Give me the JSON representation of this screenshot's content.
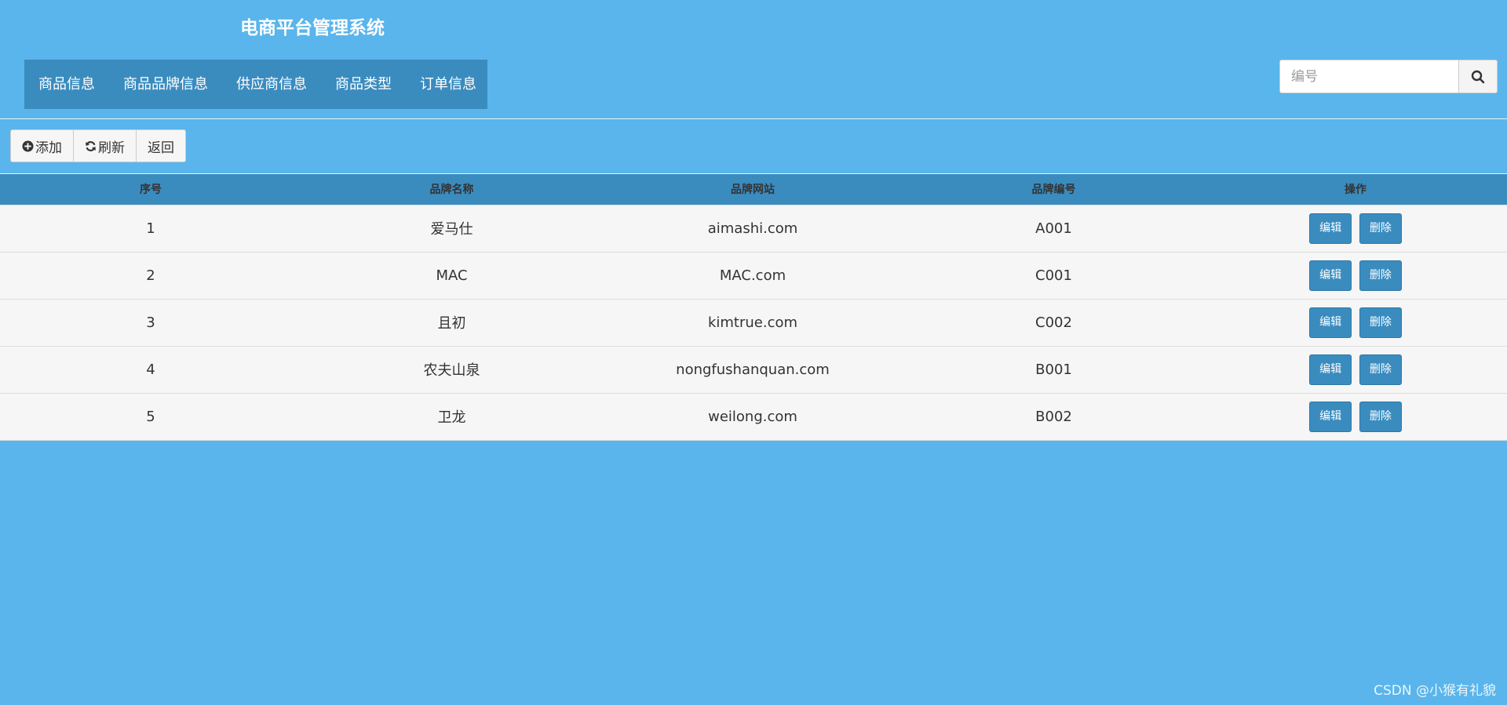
{
  "header": {
    "title": "电商平台管理系统",
    "nav": [
      {
        "label": "商品信息"
      },
      {
        "label": "商品品牌信息"
      },
      {
        "label": "供应商信息"
      },
      {
        "label": "商品类型"
      },
      {
        "label": "订单信息"
      }
    ],
    "search": {
      "placeholder": "编号",
      "value": "",
      "button_icon": "search-icon"
    }
  },
  "toolbar": {
    "add_label": "添加",
    "add_icon": "plus-circle-icon",
    "refresh_label": "刷新",
    "refresh_icon": "refresh-icon",
    "back_label": "返回"
  },
  "table": {
    "columns": [
      "序号",
      "品牌名称",
      "品牌网站",
      "品牌编号",
      "操作"
    ],
    "rows": [
      {
        "index": "1",
        "name": "爱马仕",
        "site": "aimashi.com",
        "code": "A001",
        "edit": "编辑",
        "delete": "删除"
      },
      {
        "index": "2",
        "name": "MAC",
        "site": "MAC.com",
        "code": "C001",
        "edit": "编辑",
        "delete": "删除"
      },
      {
        "index": "3",
        "name": "且初",
        "site": "kimtrue.com",
        "code": "C002",
        "edit": "编辑",
        "delete": "删除"
      },
      {
        "index": "4",
        "name": "农夫山泉",
        "site": "nongfushanquan.com",
        "code": "B001",
        "edit": "编辑",
        "delete": "删除"
      },
      {
        "index": "5",
        "name": "卫龙",
        "site": "weilong.com",
        "code": "B002",
        "edit": "编辑",
        "delete": "删除"
      }
    ]
  },
  "watermark": "CSDN @小猴有礼貌",
  "colors": {
    "background": "#59b5eb",
    "nav": "#3a8cbf",
    "table_header": "#3a8cbf",
    "button": "#3a8cbf",
    "row": "#f6f6f6"
  }
}
